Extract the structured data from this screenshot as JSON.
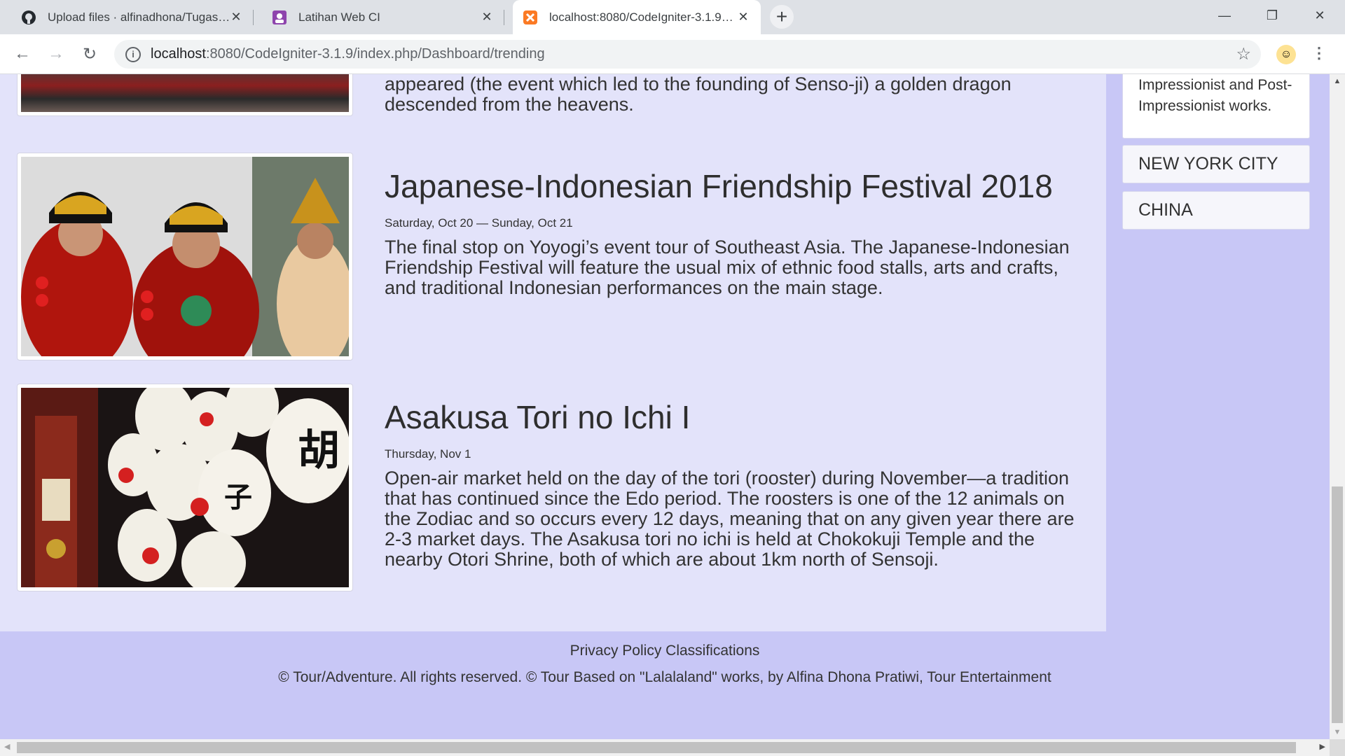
{
  "browser": {
    "tabs": [
      {
        "title": "Upload files · alfinadhona/Tugas…",
        "icon": "github-icon"
      },
      {
        "title": "Latihan Web CI",
        "icon": "profile-icon"
      },
      {
        "title": "localhost:8080/CodeIgniter-3.1.9…",
        "icon": "xampp-icon"
      }
    ],
    "url_host": "localhost",
    "url_path": ":8080/CodeIgniter-3.1.9/index.php/Dashboard/trending"
  },
  "main": {
    "top_fragment": "appeared (the event which led to the founding of Senso-ji) a golden dragon descended from the heavens.",
    "events": [
      {
        "title": "Japanese-Indonesian Friendship Festival 2018",
        "date": "Saturday, Oct 20 — Sunday, Oct 21",
        "description": "The final stop on Yoyogi’s event tour of Southeast Asia. The Japanese-Indonesian Friendship Festival will feature the usual mix of ethnic food stalls, arts and crafts, and traditional Indonesian performances on the main stage."
      },
      {
        "title": "Asakusa Tori no Ichi I",
        "date": "Thursday, Nov 1",
        "description": "Open-air market held on the day of the tori (rooster) during November—a tradition that has continued since the Edo period. The roosters is one of the 12 animals on the Zodiac and so occurs every 12 days, meaning that on any given year there are 2-3 market days. The Asakusa tori no ichi is held at Chokokuji Temple and the nearby Otori Shrine, both of which are about 1km north of Sensoji."
      }
    ]
  },
  "sidebar": {
    "card_text": "Impressionist and Post-Impressionist works.",
    "items": [
      "NEW YORK CITY",
      "CHINA"
    ]
  },
  "footer": {
    "links": "Privacy Policy Classifications",
    "copyright": "© Tour/Adventure. All rights reserved. © Tour Based on \"Lalalaland\" works, by Alfina Dhona Pratiwi, Tour Entertainment"
  },
  "colors": {
    "main_bg": "#e3e3fa",
    "page_bg": "#c8c7f6"
  }
}
